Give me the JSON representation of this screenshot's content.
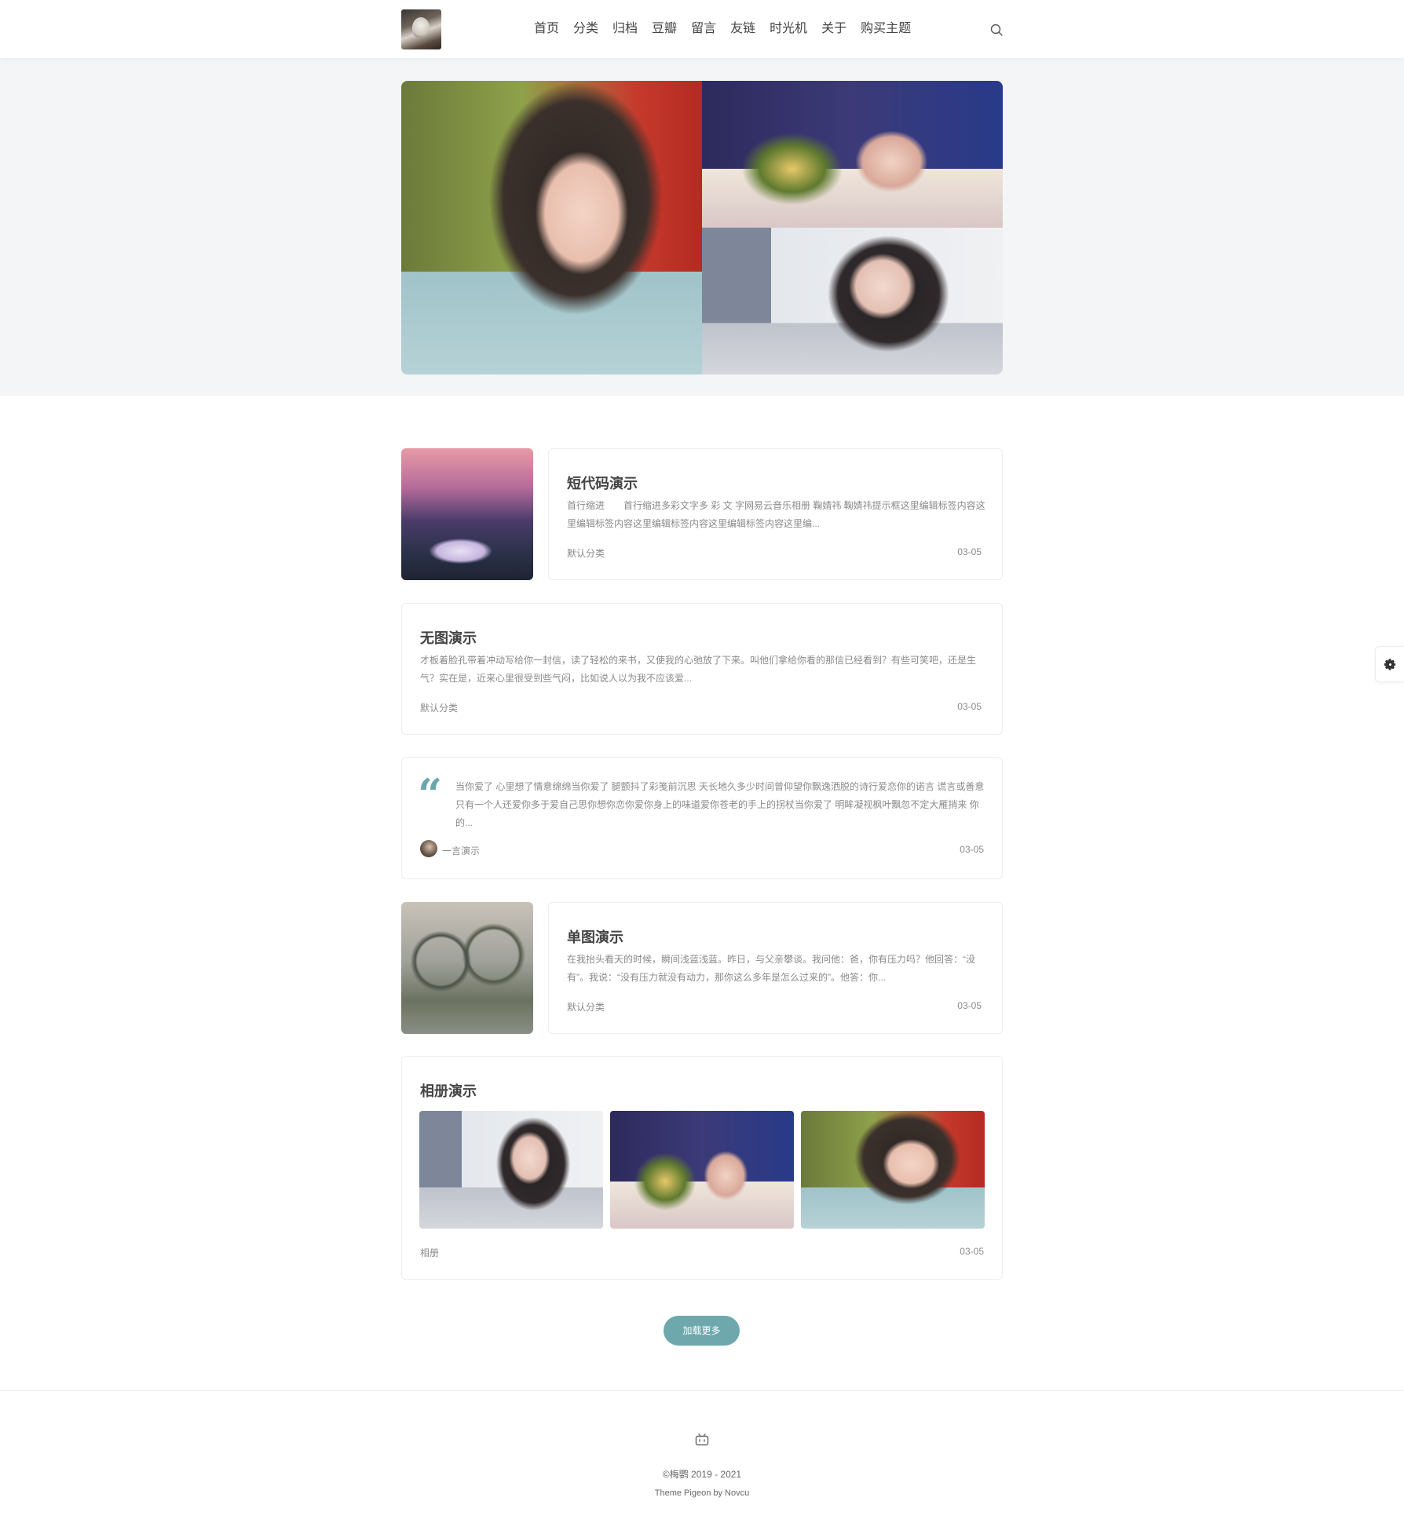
{
  "nav": {
    "items": [
      {
        "label": "首页"
      },
      {
        "label": "分类"
      },
      {
        "label": "归档"
      },
      {
        "label": "豆瓣"
      },
      {
        "label": "留言"
      },
      {
        "label": "友链"
      },
      {
        "label": "时光机"
      },
      {
        "label": "关于"
      },
      {
        "label": "购买主题"
      }
    ]
  },
  "posts": [
    {
      "title": "短代码演示",
      "excerpt": "首行缩进　　首行缩进多彩文字多 彩 文 字网易云音乐相册 鞠婧祎 鞠婧祎提示框这里编辑标签内容这里编辑标签内容这里编辑标签内容这里编辑标签内容这里编...",
      "category": "默认分类",
      "date": "03-05"
    },
    {
      "title": "无图演示",
      "excerpt": "才板着脸孔带着冲动写给你一封信，读了轻松的来书，又使我的心弛放了下来。叫他们拿给你看的那信已经看到？有些可笑吧，还是生气？实在是，近来心里很受到些气闷，比如说人以为我不应该爱...",
      "category": "默认分类",
      "date": "03-05"
    },
    {
      "excerpt": "当你爱了 心里想了情意绵绵当你爱了 腿颤抖了彩笺前沉思 天长地久多少时间曾仰望你飘逸洒脱的诗行爱恋你的诺言 谎言或善意只有一个人还爱你多于爱自己思你想你恋你爱你身上的味道爱你苍老的手上的拐杖当你爱了 明眸凝视枫叶飘忽不定大雁捎来 你的...",
      "category": "一言演示",
      "date": "03-05"
    },
    {
      "title": "单图演示",
      "excerpt": "在我抬头看天的时候，瞬间浅蓝浅蓝。昨日，与父亲攀谈。我问他：爸，你有压力吗？他回答：“没有”。我说：“没有压力就没有动力，那你这么多年是怎么过来的”。他答：你...",
      "category": "默认分类",
      "date": "03-05"
    },
    {
      "title": "相册演示",
      "category": "相册",
      "date": "03-05"
    }
  ],
  "load_more": {
    "label": "加载更多"
  },
  "footer": {
    "copyright": "©梅鹦 2019 - 2021",
    "theme": "Theme Pigeon by Novcu"
  },
  "colors": {
    "accent": "#6ea8ad"
  },
  "icons": [
    "search-icon",
    "gear-icon",
    "bilibili-icon",
    "quote-icon"
  ]
}
